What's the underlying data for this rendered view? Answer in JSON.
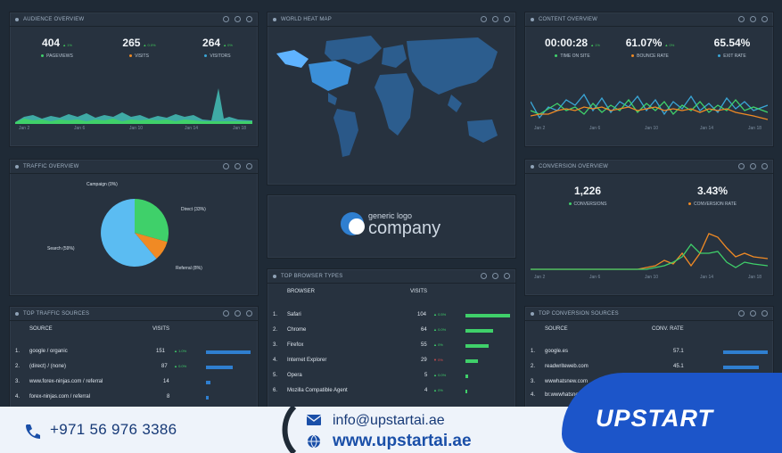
{
  "audience": {
    "title": "AUDIENCE OVERVIEW",
    "kpis": [
      {
        "value": "404",
        "change": "▲ 1%",
        "label": "PAGEVIEWS",
        "color": "#3fd06a"
      },
      {
        "value": "265",
        "change": "▲ 0.0%",
        "label": "VISITS",
        "color": "#f08a24"
      },
      {
        "value": "264",
        "change": "▲ 0%",
        "label": "VISITORS",
        "color": "#3aa6d6"
      }
    ],
    "axis": [
      "Jan 2",
      "Jan 6",
      "Jan 10",
      "Jan 14",
      "Jan 18"
    ]
  },
  "traffic": {
    "title": "TRAFFIC OVERVIEW",
    "slices": [
      {
        "label": "Campaign (0%)",
        "pct": 0,
        "color": "#e0e0e0"
      },
      {
        "label": "Direct (33%)",
        "pct": 33,
        "color": "#3fd06a"
      },
      {
        "label": "Referral (8%)",
        "pct": 8,
        "color": "#f08a24"
      },
      {
        "label": "Search (59%)",
        "pct": 59,
        "color": "#5bbcf2"
      }
    ]
  },
  "top_traffic": {
    "title": "TOP TRAFFIC SOURCES",
    "col1": "SOURCE",
    "col2": "VISITS",
    "rows": [
      {
        "n": "1.",
        "name": "google / organic",
        "v": "151",
        "chg": "▲ 1.0%",
        "bar": 1.0
      },
      {
        "n": "2.",
        "name": "(direct) / (none)",
        "v": "87",
        "chg": "▲ 0.0%",
        "bar": 0.58
      },
      {
        "n": "3.",
        "name": "www.forex-ninjas.com / referral",
        "v": "14",
        "chg": "",
        "bar": 0.09
      },
      {
        "n": "4.",
        "name": "forex-ninjas.com / referral",
        "v": "8",
        "chg": "",
        "bar": 0.05
      }
    ]
  },
  "worldmap": {
    "title": "WORLD HEAT MAP"
  },
  "logo": {
    "small": "generic logo",
    "big": "company"
  },
  "browser": {
    "title": "TOP BROWSER TYPES",
    "col1": "BROWSER",
    "col2": "VISITS",
    "rows": [
      {
        "n": "1.",
        "name": "Safari",
        "v": "104",
        "chg": "▲ 0.5%",
        "bar": 1.0
      },
      {
        "n": "2.",
        "name": "Chrome",
        "v": "64",
        "chg": "▲ 0.0%",
        "bar": 0.62
      },
      {
        "n": "3.",
        "name": "Firefox",
        "v": "55",
        "chg": "▲ 0%",
        "bar": 0.53
      },
      {
        "n": "4.",
        "name": "Internet Explorer",
        "v": "29",
        "chg": "▼ 0%",
        "bar": 0.28
      },
      {
        "n": "5.",
        "name": "Opera",
        "v": "5",
        "chg": "▲ 0.0%",
        "bar": 0.05
      },
      {
        "n": "6.",
        "name": "Mozilla Compatible Agent",
        "v": "4",
        "chg": "▲ 0%",
        "bar": 0.04
      }
    ]
  },
  "content": {
    "title": "CONTENT OVERVIEW",
    "kpis": [
      {
        "value": "00:00:28",
        "change": "▲ 1%",
        "label": "TIME ON SITE",
        "color": "#3fd06a"
      },
      {
        "value": "61.07%",
        "change": "▲ 0%",
        "label": "BOUNCE RATE",
        "color": "#f08a24"
      },
      {
        "value": "65.54%",
        "change": "",
        "label": "EXIT RATE",
        "color": "#3aa6d6"
      }
    ],
    "axis": [
      "Jan 2",
      "Jan 6",
      "Jan 10",
      "Jan 14",
      "Jan 18"
    ]
  },
  "conversion": {
    "title": "CONVERSION OVERVIEW",
    "kpis": [
      {
        "value": "1,226",
        "label": "CONVERSIONS",
        "color": "#3fd06a"
      },
      {
        "value": "3.43%",
        "label": "CONVERSION RATE",
        "color": "#f08a24"
      }
    ],
    "axis": [
      "Jan 2",
      "Jan 6",
      "Jan 10",
      "Jan 14",
      "Jan 18"
    ]
  },
  "top_conv": {
    "title": "TOP CONVERSION SOURCES",
    "col1": "SOURCE",
    "col2": "CONV. RATE",
    "rows": [
      {
        "n": "1.",
        "name": "google.es",
        "v": "57.1",
        "bar": 1.0
      },
      {
        "n": "2.",
        "name": "readwriteweb.com",
        "v": "45.1",
        "bar": 0.79
      },
      {
        "n": "3.",
        "name": "wwwhatsnew.com",
        "v": "",
        "bar": 0
      },
      {
        "n": "4.",
        "name": "br.wwwhatsnew.com",
        "v": "",
        "bar": 0
      }
    ]
  },
  "contact": {
    "phone": "+971 56 976 3386",
    "email": "info@upstartai.ae",
    "website": "www.upstartai.ae",
    "brand": "UPSTART"
  }
}
